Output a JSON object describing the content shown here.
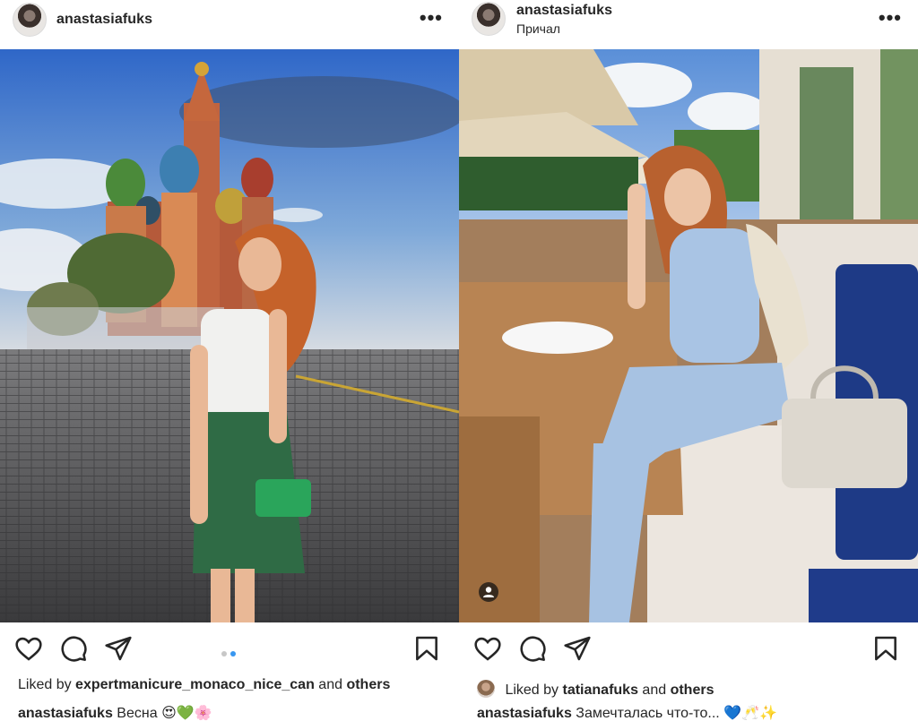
{
  "posts": [
    {
      "username": "anastasiafuks",
      "location": "",
      "liked_by": "expertmanicure_monaco_nice_can",
      "liked_and": "and",
      "liked_others": "others",
      "liked_prefix": "Liked by",
      "caption_user": "anastasiafuks",
      "caption_text": "Весна",
      "caption_emoji": "😍💚🌸",
      "carousel": {
        "count": 2,
        "active": 2
      }
    },
    {
      "username": "anastasiafuks",
      "location": "Причал",
      "liked_by": "tatianafuks",
      "liked_and": "and",
      "liked_others": "others",
      "liked_prefix": "Liked by",
      "caption_user": "anastasiafuks",
      "caption_text": "Замечталась что-то...",
      "caption_emoji": "💙🥂✨"
    }
  ],
  "icons": {
    "more": "more-options-icon",
    "like": "heart-icon",
    "comment": "comment-icon",
    "share": "share-icon",
    "save": "bookmark-icon",
    "user_tag": "user-tag-icon"
  },
  "colors": {
    "text": "#262626",
    "carousel_active": "#3897f0",
    "carousel_inactive": "#c7c7c7"
  }
}
